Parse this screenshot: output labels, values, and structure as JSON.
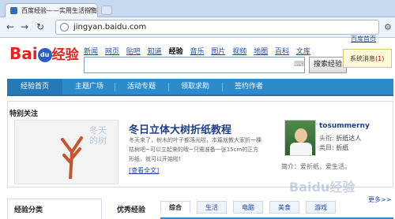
{
  "browser": {
    "tab_title": "百度经验——实用生活指南",
    "url": "jingyan.baidu.com"
  },
  "site": {
    "logo_bai": "Bai",
    "logo_du": "du",
    "logo_jingyan": "经验",
    "nav": [
      "新闻",
      "网页",
      "贴吧",
      "知道",
      "经验",
      "音乐",
      "图片",
      "视频",
      "地图",
      "百科",
      "文库"
    ],
    "search_button": "搜索经验",
    "top_help": "百度首页",
    "message_label": "系统消息",
    "message_count": "(1)"
  },
  "bluebar": [
    "经验首页",
    "主题广场",
    "活动专题",
    "领取求助",
    "签约作者"
  ],
  "featured": {
    "section_title": "特别关注",
    "article_title": "冬日立体大树折纸教程",
    "article_body": "冬天来了，树木的叶子都落光啦，本篇就教大家折一棵枯树吧~可以立起来的哦~只需准备一张15cm的正方形纸，就可以开始啦!",
    "read_more": "[查看全文]",
    "image_calligraphy": "冬天的树",
    "author": {
      "name": "tosummerny",
      "title_label": "头衔:",
      "title_value": "折纸达人",
      "category_label": "类目:",
      "category_value": "折纸",
      "motto": "简介：爱折纸，爱生活。"
    }
  },
  "bottom": {
    "categories_title": "经验分类",
    "best_title": "优秀经验",
    "tabs": [
      "综合",
      "生活",
      "电脑",
      "美食",
      "游戏"
    ],
    "more": "更多>>"
  },
  "watermark": "Baidu经验"
}
